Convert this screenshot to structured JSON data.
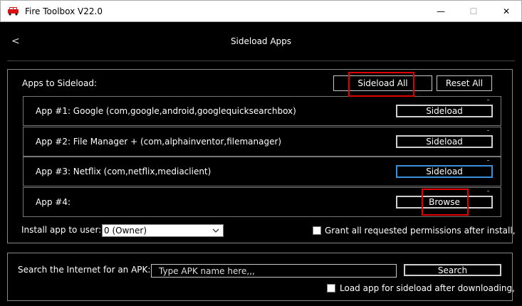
{
  "window": {
    "title": "Fire Toolbox V22.0",
    "minimize_glyph": "—",
    "maximize_glyph": "☐",
    "close_glyph": "✕",
    "app_icon": "red-car-icon"
  },
  "header": {
    "back_glyph": "<",
    "title": "Sideload Apps"
  },
  "apps": {
    "section_label": "Apps to Sideload:",
    "sideload_all_label": "Sideload All",
    "reset_all_label": "Reset All",
    "rows": [
      {
        "name": "App #1: Google (com,google,android,googlequicksearchbox)",
        "button": "Sideload"
      },
      {
        "name": "App #2: File Manager + (com,alphainventor,filemanager)",
        "button": "Sideload"
      },
      {
        "name": "App #3: Netflix (com,netflix,mediaclient)",
        "button": "Sideload"
      },
      {
        "name": "App #4:",
        "button": "Browse"
      }
    ],
    "install_user_label": "Install app to user:",
    "install_user_value": "0 (Owner)",
    "grant_permissions_label": "Grant all requested permissions after install,"
  },
  "search": {
    "label": "Search the Internet for an APK:",
    "placeholder": "Type APK name here,,,",
    "button_label": "Search",
    "load_after_label": "Load app for sideload after downloading,"
  },
  "colors": {
    "background": "#000000",
    "highlight_red": "#e00000",
    "focus_blue": "#3b8fdc"
  }
}
